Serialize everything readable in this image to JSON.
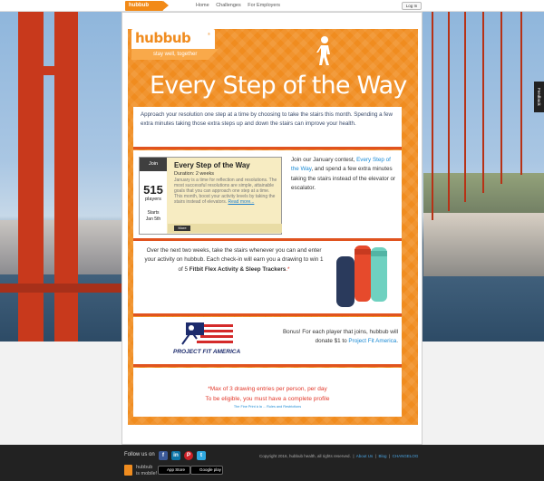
{
  "topbar": {
    "logo": "hubbub",
    "nav": [
      "Home",
      "Challenges",
      "For Employers"
    ],
    "login_label": "Log In"
  },
  "feedback_label": "Feedback",
  "brand": {
    "name": "hubbub",
    "tagline": "stay well, together"
  },
  "hero": {
    "title": "Every Step of the Way"
  },
  "intro": {
    "text": "Approach your resolution one step at a time by choosing to take the stairs this month. Spending a few extra minutes taking those extra steps up and down the stairs can improve your health."
  },
  "challenge": {
    "join_label": "Join",
    "players_count": "515",
    "players_label": "players",
    "starts_label": "Starts",
    "starts_date": "Jan 5th",
    "title": "Every Step of the Way",
    "duration": "Duration: 2 weeks",
    "description": "January is a time for reflection and resolutions. The most successful resolutions are simple, attainable goals that you can approach one step at a time. This month, boost your activity levels by taking the stairs instead of elevators.",
    "read_more": "Read more...",
    "more_button": "More"
  },
  "contest": {
    "text_before": "Join our January contest, ",
    "link": "Every Step of the Way",
    "text_after": ", and spend a few extra minutes taking the stairs instead of the elevator or escalator."
  },
  "drawing": {
    "text": "Over the next two weeks, take the stairs whenever you can and enter your activity on hubbub. Each check-in will earn you a drawing to win 1 of 5 ",
    "prize": "Fitbit Flex Activity & Sleep Trackers",
    "asterisk": ".*"
  },
  "bonus": {
    "text": "Bonus! For each player that joins, hubbub will donate $1 to ",
    "link": "Project Fit America",
    "end": ".",
    "logo_text": "PROJECT FIT AMERICA"
  },
  "rules": {
    "line1": "*Max of 3 drawing entries per person, per day",
    "line2": "To be eligible, you must have a complete profile",
    "fine_print": "The Fine Print à la ... Rules and Restrictions"
  },
  "footer": {
    "follow_label": "Follow us on",
    "social": [
      {
        "icon": "facebook-icon",
        "glyph": "f",
        "color": "#3b5998"
      },
      {
        "icon": "linkedin-icon",
        "glyph": "in",
        "color": "#0e76a8"
      },
      {
        "icon": "pinterest-icon",
        "glyph": "P",
        "color": "#cb2027"
      },
      {
        "icon": "twitter-icon",
        "glyph": "t",
        "color": "#2fa8e0"
      }
    ],
    "mobile_line1": "hubbub",
    "mobile_line2": "is mobile!",
    "app_store": "App Store",
    "google_play": "Google play",
    "copyright": "Copyright 2016, hubbub health, all rights reserved.",
    "links": [
      "About Us",
      "Blog",
      "CHANGELOG"
    ]
  }
}
